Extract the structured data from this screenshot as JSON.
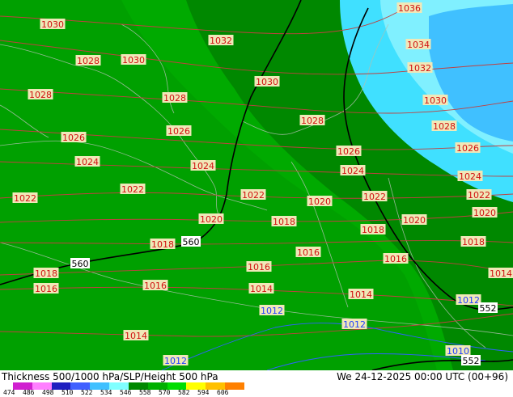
{
  "title": "Thickness 500/1000 hPa/SLP/Height 500 hPa",
  "datetime": "We 24-12-2025 00:00 UTC (00+96)",
  "legend": {
    "ticks": [
      "474",
      "486",
      "498",
      "510",
      "522",
      "534",
      "546",
      "558",
      "570",
      "582",
      "594",
      "606"
    ],
    "colors": [
      "#d020d0",
      "#ff80ff",
      "#2020c0",
      "#4060ff",
      "#40c0ff",
      "#80ffff",
      "#008800",
      "#00b000",
      "#00dd00",
      "#ffff00",
      "#ffc000",
      "#ff8000"
    ]
  },
  "colors": {
    "thickness_546": "#008800",
    "thickness_534": "#00a000",
    "thickness_540": "#00aa00",
    "thickness_cyan": "#40e0ff",
    "thickness_light_cyan": "#80f0ff",
    "thickness_blue": "#40c0ff",
    "isobar_red": "#c04040",
    "isobar_blue": "#3060ff",
    "height_line": "#000000"
  },
  "isobar_labels": [
    {
      "text": "1036",
      "color": "red"
    },
    {
      "text": "1034",
      "color": "red"
    },
    {
      "text": "1032",
      "color": "red"
    },
    {
      "text": "1032",
      "color": "red"
    },
    {
      "text": "1030",
      "color": "red"
    },
    {
      "text": "1030",
      "color": "red"
    },
    {
      "text": "1030",
      "color": "red"
    },
    {
      "text": "1030",
      "color": "red"
    },
    {
      "text": "1028",
      "color": "red"
    },
    {
      "text": "1028",
      "color": "red"
    },
    {
      "text": "1028",
      "color": "red"
    },
    {
      "text": "1028",
      "color": "red"
    },
    {
      "text": "1028",
      "color": "red"
    },
    {
      "text": "1026",
      "color": "red"
    },
    {
      "text": "1026",
      "color": "red"
    },
    {
      "text": "1026",
      "color": "red"
    },
    {
      "text": "1026",
      "color": "red"
    },
    {
      "text": "1024",
      "color": "red"
    },
    {
      "text": "1024",
      "color": "red"
    },
    {
      "text": "1024",
      "color": "red"
    },
    {
      "text": "1024",
      "color": "red"
    },
    {
      "text": "1022",
      "color": "red"
    },
    {
      "text": "1022",
      "color": "red"
    },
    {
      "text": "1022",
      "color": "red"
    },
    {
      "text": "1022",
      "color": "red"
    },
    {
      "text": "1022",
      "color": "red"
    },
    {
      "text": "1020",
      "color": "red"
    },
    {
      "text": "1020",
      "color": "red"
    },
    {
      "text": "1020",
      "color": "red"
    },
    {
      "text": "1020",
      "color": "red"
    },
    {
      "text": "1018",
      "color": "red"
    },
    {
      "text": "1018",
      "color": "red"
    },
    {
      "text": "1018",
      "color": "red"
    },
    {
      "text": "1018",
      "color": "red"
    },
    {
      "text": "1016",
      "color": "red"
    },
    {
      "text": "1016",
      "color": "red"
    },
    {
      "text": "1016",
      "color": "red"
    },
    {
      "text": "1016",
      "color": "red"
    },
    {
      "text": "1016",
      "color": "red"
    },
    {
      "text": "1018",
      "color": "red"
    },
    {
      "text": "1014",
      "color": "red"
    },
    {
      "text": "1014",
      "color": "red"
    },
    {
      "text": "1014",
      "color": "red"
    },
    {
      "text": "1014",
      "color": "red"
    },
    {
      "text": "1012",
      "color": "blue"
    },
    {
      "text": "1012",
      "color": "blue"
    },
    {
      "text": "1012",
      "color": "blue"
    },
    {
      "text": "1012",
      "color": "blue"
    },
    {
      "text": "1010",
      "color": "blue"
    }
  ],
  "height_labels": [
    "560",
    "560",
    "552",
    "552"
  ]
}
